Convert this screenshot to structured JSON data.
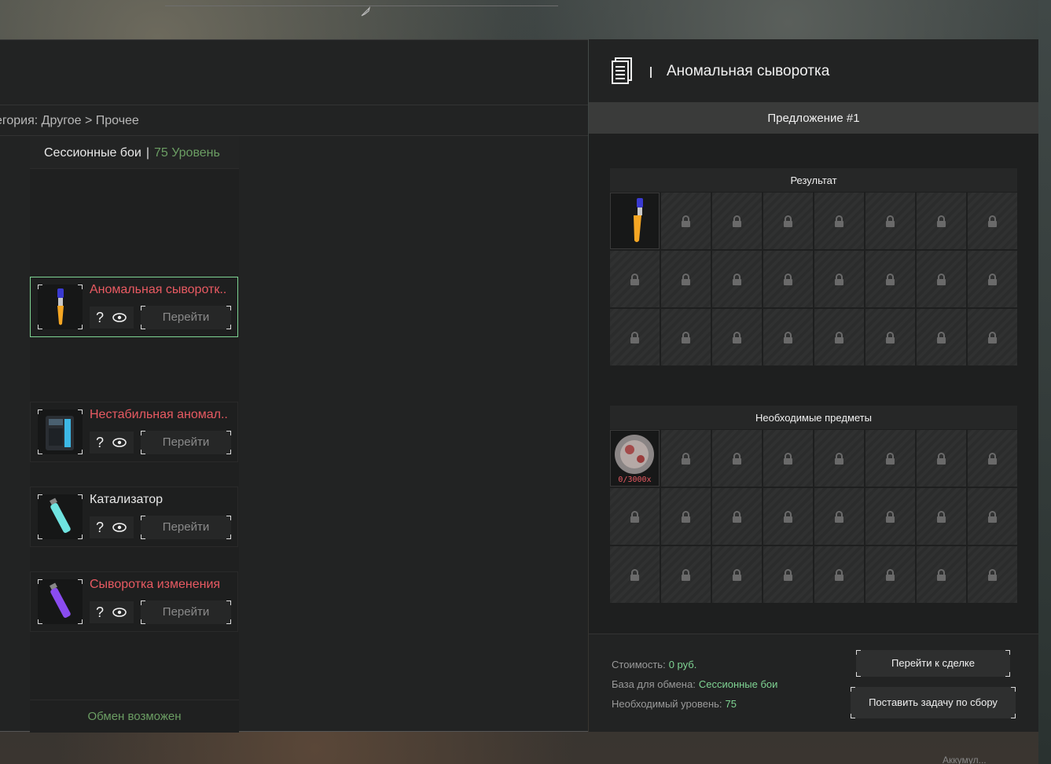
{
  "category": {
    "text": "егория: Другое > Прочее"
  },
  "list": {
    "section": "Сессионные бои",
    "level": "75 Уровень",
    "items": [
      {
        "name": "Аномальная сыворотк..",
        "q": "?",
        "go": "Перейти",
        "color": "red"
      },
      {
        "name": "Нестабильная аномал..",
        "q": "?",
        "go": "Перейти",
        "color": "red"
      },
      {
        "name": "Катализатор",
        "q": "?",
        "go": "Перейти",
        "color": "white"
      },
      {
        "name": "Сыворотка изменения",
        "q": "?",
        "go": "Перейти",
        "color": "red"
      }
    ],
    "footer": "Обмен возможен"
  },
  "detail": {
    "title": "Аномальная сыворотка",
    "offer_tab": "Предложение #1",
    "result_title": "Результат",
    "required_title": "Необходимые предметы",
    "required_count": "0/3000x",
    "cost_label": "Стоимость:",
    "cost_value": "0 руб.",
    "base_label": "База для обмена:",
    "base_value": "Сессионные бои",
    "level_label": "Необходимый уровень:",
    "level_value": "75",
    "deal_button": "Перейти к сделке",
    "task_button": "Поставить задачу по сбору"
  },
  "background": {
    "bottom_hint": "Аккумул..."
  },
  "colors": {
    "accent_green": "#7fd493",
    "level_green": "#6b9e63",
    "name_red": "#e85a62",
    "panel": "#222323"
  }
}
